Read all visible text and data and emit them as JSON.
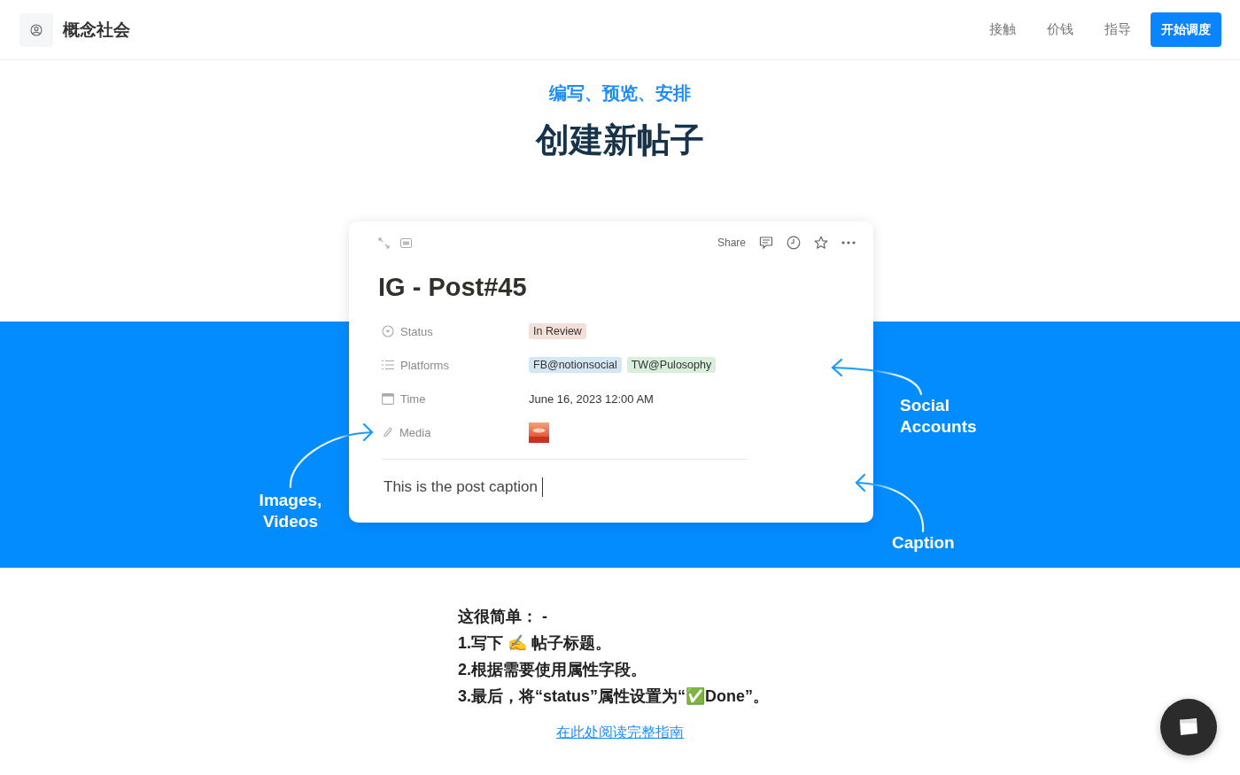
{
  "header": {
    "brand": "概念社会",
    "nav": [
      {
        "label": "接触"
      },
      {
        "label": "价钱"
      },
      {
        "label": "指导"
      }
    ],
    "cta": "开始调度"
  },
  "hero": {
    "eyebrow": "编写、预览、安排",
    "title": "创建新帖子"
  },
  "card": {
    "share": "Share",
    "title": "IG - Post#45",
    "properties": [
      {
        "kind": "status",
        "label": "Status",
        "tags": [
          {
            "text": "In Review",
            "color": "#f3e1d9"
          }
        ]
      },
      {
        "kind": "platforms",
        "label": "Platforms",
        "tags": [
          {
            "text": "FB@notionsocial",
            "color": "#d6e7f4"
          },
          {
            "text": "TW@Pulosophy",
            "color": "#d9efdc"
          }
        ]
      },
      {
        "kind": "time",
        "label": "Time",
        "value": "June 16, 2023 12:00 AM"
      },
      {
        "kind": "media",
        "label": "Media"
      }
    ],
    "caption": "This is the post caption"
  },
  "annotations": [
    {
      "kind": "social",
      "text": "Social Accounts"
    },
    {
      "kind": "caption",
      "text": "Caption"
    },
    {
      "kind": "media",
      "text": "Images, Videos"
    }
  ],
  "instructions": {
    "intro": "这很简单： -",
    "steps": [
      "1.写下 ✍️ 帖子标题。",
      "2.根据需要使用属性字段。",
      "3.最后，将“status”属性设置为“✅Done”。"
    ]
  },
  "guide_link": "在此处阅读完整指南"
}
